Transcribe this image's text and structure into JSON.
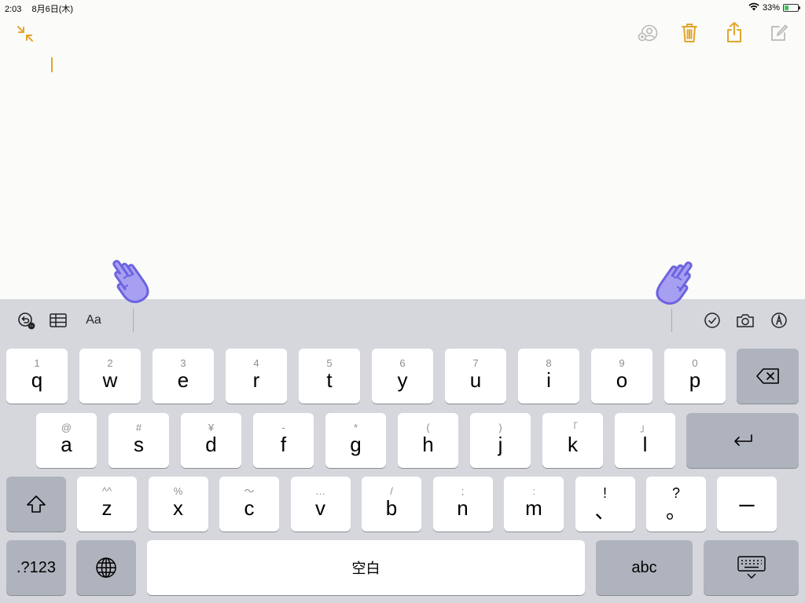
{
  "status": {
    "time": "2:03",
    "date": "8月6日(木)",
    "battery": "33%",
    "battery_level": 0.33
  },
  "keyboard": {
    "row1": [
      {
        "hint": "1",
        "char": "q"
      },
      {
        "hint": "2",
        "char": "w"
      },
      {
        "hint": "3",
        "char": "e"
      },
      {
        "hint": "4",
        "char": "r"
      },
      {
        "hint": "5",
        "char": "t"
      },
      {
        "hint": "6",
        "char": "y"
      },
      {
        "hint": "7",
        "char": "u"
      },
      {
        "hint": "8",
        "char": "i"
      },
      {
        "hint": "9",
        "char": "o"
      },
      {
        "hint": "0",
        "char": "p"
      }
    ],
    "row2": [
      {
        "hint": "@",
        "char": "a"
      },
      {
        "hint": "#",
        "char": "s"
      },
      {
        "hint": "¥",
        "char": "d"
      },
      {
        "hint": "-",
        "char": "f"
      },
      {
        "hint": "*",
        "char": "g"
      },
      {
        "hint": "(",
        "char": "h"
      },
      {
        "hint": ")",
        "char": "j"
      },
      {
        "hint": "「",
        "char": "k"
      },
      {
        "hint": "」",
        "char": "l"
      }
    ],
    "row3": [
      {
        "hint": "^^",
        "char": "z"
      },
      {
        "hint": "%",
        "char": "x"
      },
      {
        "hint": "〜",
        "char": "c"
      },
      {
        "hint": "…",
        "char": "v"
      },
      {
        "hint": "/",
        "char": "b"
      },
      {
        "hint": ";",
        "char": "n"
      },
      {
        "hint": ":",
        "char": "m"
      },
      {
        "hint": "!",
        "char": "、"
      },
      {
        "hint": "?",
        "char": "。"
      }
    ],
    "dash_label": "ー",
    "numbers_label": ".?123",
    "space_label": "空白",
    "abc_label": "abc",
    "shortcut_text_format": "Aa"
  }
}
